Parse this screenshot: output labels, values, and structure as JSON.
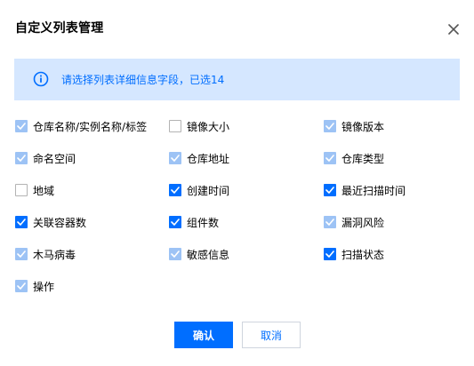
{
  "dialog": {
    "title": "自定义列表管理",
    "info_text": "请选择列表详细信息字段，已选14",
    "confirm_label": "确认",
    "cancel_label": "取消"
  },
  "colors": {
    "primary": "#006eff",
    "checked_disabled": "#9dc3f5",
    "info_bg": "#d5e7ff"
  },
  "fields": [
    {
      "label": "仓库名称/实例名称/标签",
      "state": "disabled-checked"
    },
    {
      "label": "镜像大小",
      "state": "unchecked"
    },
    {
      "label": "镜像版本",
      "state": "disabled-checked"
    },
    {
      "label": "命名空间",
      "state": "disabled-checked"
    },
    {
      "label": "仓库地址",
      "state": "disabled-checked"
    },
    {
      "label": "仓库类型",
      "state": "disabled-checked"
    },
    {
      "label": "地域",
      "state": "unchecked"
    },
    {
      "label": "创建时间",
      "state": "checked"
    },
    {
      "label": "最近扫描时间",
      "state": "checked"
    },
    {
      "label": "关联容器数",
      "state": "checked"
    },
    {
      "label": "组件数",
      "state": "checked"
    },
    {
      "label": "漏洞风险",
      "state": "disabled-checked"
    },
    {
      "label": "木马病毒",
      "state": "disabled-checked"
    },
    {
      "label": "敏感信息",
      "state": "disabled-checked"
    },
    {
      "label": "扫描状态",
      "state": "checked"
    },
    {
      "label": "操作",
      "state": "disabled-checked"
    }
  ]
}
